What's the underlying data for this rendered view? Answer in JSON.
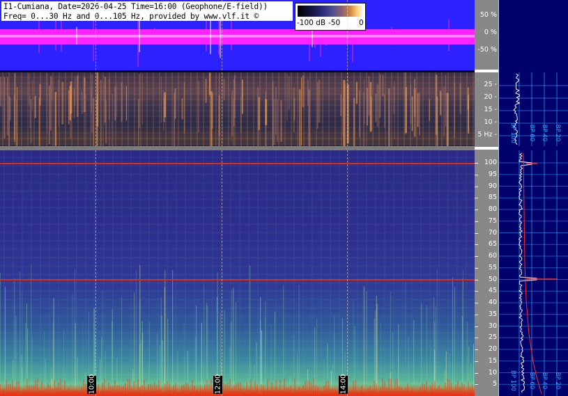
{
  "header": {
    "title_line1": "I1-Cumiana, Date=2026-04-25 Time=16:00 (Geophone/E-field))",
    "title_line2": "Freq= 0...30 Hz and 0...105 Hz, provided by www.vlf.it ©"
  },
  "colorbar": {
    "labels": [
      "-100 dB",
      "-50",
      "0"
    ],
    "colors": [
      "#000000",
      "#2c2f7a",
      "#d3883f",
      "#fff4e0"
    ]
  },
  "waveform": {
    "ticks": [
      "50 %",
      "0 %",
      "-50 %"
    ],
    "colors": {
      "background": "#2b22ff",
      "signal": "#ff22ff",
      "core": "#ffffff"
    }
  },
  "spectrogram_low": {
    "ticks": [
      "25 -",
      "20 -",
      "15 -",
      "10 -",
      "5 Hz -"
    ]
  },
  "spectrogram_high": {
    "ticks": [
      "100",
      "95",
      "90",
      "85",
      "80",
      "75",
      "70",
      "65",
      "60",
      "55",
      "50",
      "45",
      "40",
      "35",
      "30",
      "25",
      "20",
      "15",
      "10",
      "5"
    ],
    "line_color": "#d83010"
  },
  "time_markers": [
    "10:00",
    "12:00",
    "14:00"
  ],
  "right_panel": {
    "bp_labels_top": [
      "BP 100",
      "BP 60",
      "BP 40",
      "BP 20"
    ],
    "bp_labels_bottom": [
      "BP 100",
      "BP 60",
      "BP 40",
      "BP 20"
    ],
    "grid_color": "#2fa8ff"
  }
}
